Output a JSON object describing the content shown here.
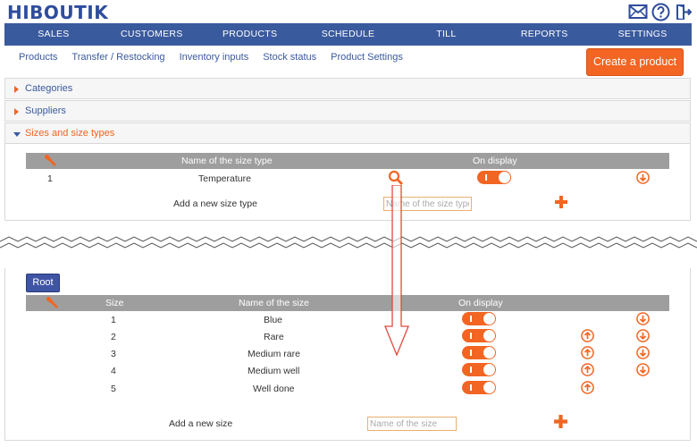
{
  "app": {
    "logo": "HIBOUTIK"
  },
  "header_icons": [
    "envelope-icon",
    "help-icon",
    "logout-icon"
  ],
  "nav": [
    "SALES",
    "CUSTOMERS",
    "PRODUCTS",
    "SCHEDULE",
    "TILL",
    "REPORTS",
    "SETTINGS"
  ],
  "subnav": [
    "Products",
    "Transfer / Restocking",
    "Inventory inputs",
    "Stock status",
    "Product Settings"
  ],
  "create_button": "Create a product",
  "panels": {
    "categories": "Categories",
    "suppliers": "Suppliers",
    "sizes": "Sizes and size types"
  },
  "size_types_table": {
    "headers": {
      "name": "Name of the size type",
      "display": "On display"
    },
    "rows": [
      {
        "index": "1",
        "name": "Temperature"
      }
    ],
    "add_label": "Add a new size type",
    "add_placeholder": "Name of the size type"
  },
  "root_button": "Root",
  "sizes_table": {
    "headers": {
      "size": "Size",
      "name": "Name of the size",
      "display": "On display"
    },
    "rows": [
      {
        "size": "1",
        "name": "Blue"
      },
      {
        "size": "2",
        "name": "Rare"
      },
      {
        "size": "3",
        "name": "Medium rare"
      },
      {
        "size": "4",
        "name": "Medium well"
      },
      {
        "size": "5",
        "name": "Well done"
      }
    ],
    "add_label": "Add a new size",
    "add_placeholder": "Name of the size"
  },
  "colors": {
    "brand": "#2f4d9c",
    "nav": "#3a5a9e",
    "accent": "#f26522",
    "header_gray": "#9e9e9e"
  }
}
